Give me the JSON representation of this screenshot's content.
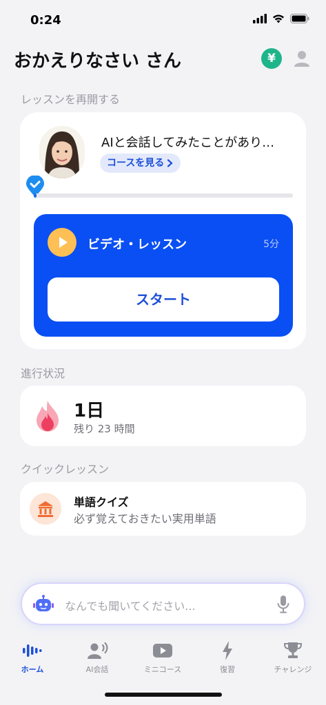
{
  "status_bar": {
    "time": "0:24"
  },
  "header": {
    "greeting": "おかえりなさい さん",
    "currency_symbol": "¥"
  },
  "resume_section": {
    "heading": "レッスンを再開する",
    "lesson_title": "AIと会話してみたことがあり…",
    "course_link_label": "コースを見る",
    "progress": 0.01,
    "video": {
      "title": "ビデオ・レッスン",
      "duration": "5分",
      "start_label": "スタート"
    }
  },
  "progress_section": {
    "heading": "進行状況",
    "streak_value": "1日",
    "remaining_text": "残り 23 時間"
  },
  "quick_section": {
    "heading": "クイックレッスン",
    "quiz_title": "単語クイズ",
    "quiz_subtitle": "必ず覚えておきたい実用単語"
  },
  "ask_bar": {
    "placeholder": "なんでも聞いてください..."
  },
  "tabs": [
    {
      "label": "ホーム",
      "icon": "home-waves-icon",
      "active": true
    },
    {
      "label": "AI会話",
      "icon": "ai-talk-icon",
      "active": false
    },
    {
      "label": "ミニコース",
      "icon": "video-icon",
      "active": false
    },
    {
      "label": "復習",
      "icon": "lightning-icon",
      "active": false
    },
    {
      "label": "チャレンジ",
      "icon": "trophy-icon",
      "active": false
    }
  ],
  "colors": {
    "accent": "#1d4fd8",
    "video_panel": "#0a4ff3",
    "play_button": "#fec054",
    "currency_badge": "#1fb58a",
    "background": "#f3f3f6"
  }
}
